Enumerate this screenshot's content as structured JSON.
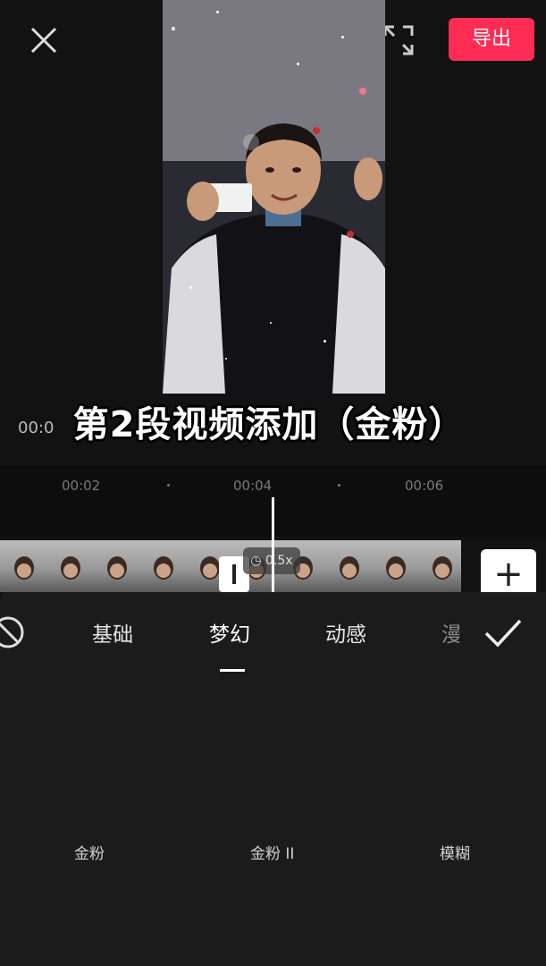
{
  "toolbar": {
    "export_label": "导出"
  },
  "preview": {
    "caption": "第2段视频添加（金粉）",
    "time": "00:0"
  },
  "timeline": {
    "ticks": [
      "00:02",
      "00:04",
      "00:06"
    ],
    "speed": "0.5x"
  },
  "effects_panel": {
    "tabs": [
      "基础",
      "梦幻",
      "动感",
      "漫"
    ],
    "selected_tab": "梦幻",
    "items": [
      "金粉",
      "金粉 II",
      "模糊"
    ]
  },
  "colors": {
    "accent": "#fe2c55",
    "background": "#121212",
    "panel": "#1b1b1b"
  }
}
